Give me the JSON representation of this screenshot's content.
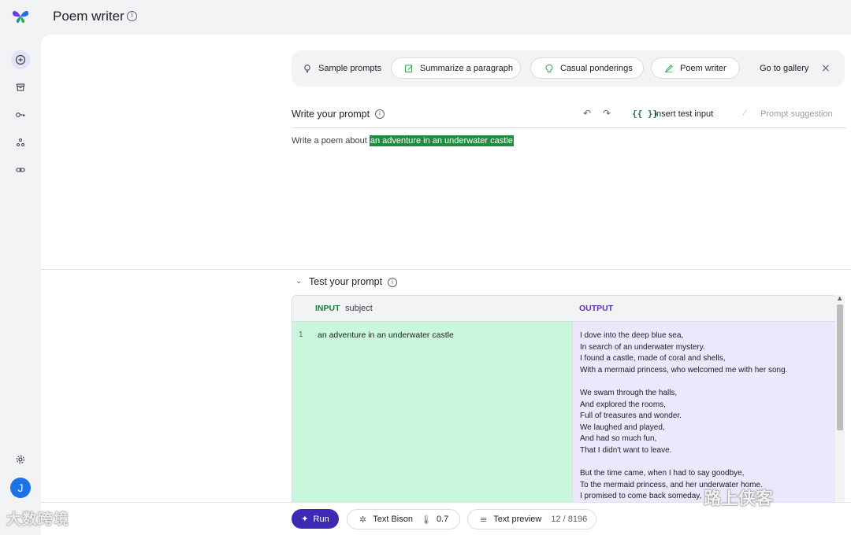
{
  "app": {
    "title": "Poem writer",
    "info_icon": "info-icon",
    "logo_icon": "butterfly-logo",
    "accent": "#3c2ab5"
  },
  "rail": {
    "items": [
      {
        "name": "new-prompt",
        "icon": "plus-circle-icon",
        "active": true
      },
      {
        "name": "library",
        "icon": "archive-icon"
      },
      {
        "name": "api-keys",
        "icon": "key-icon"
      },
      {
        "name": "tuned-models",
        "icon": "nodes-icon"
      },
      {
        "name": "links",
        "icon": "link-icon"
      }
    ],
    "settings_icon": "gear-icon",
    "avatar_initial": "J"
  },
  "chips": {
    "sample_prompts": "Sample prompts",
    "summarize": "Summarize a paragraph",
    "casual": "Casual ponderings",
    "poem_writer": "Poem writer",
    "gallery": "Go to gallery",
    "close": "×"
  },
  "prompt_panel": {
    "title": "Write your prompt",
    "undo": "↶",
    "redo": "↷",
    "insert_icon": "{{ }}",
    "insert_label": "Insert test input",
    "suggestion_label": "Prompt suggestion",
    "text_prefix": "Write a poem about ",
    "text_variable": "an adventure in an underwater castle",
    "variable_color": "#1e8e3e"
  },
  "test_panel": {
    "title": "Test your prompt",
    "input_label": "INPUT",
    "input_name": "subject",
    "output_label": "OUTPUT",
    "input_color": "#188038",
    "output_color": "#5e35b1",
    "rows": [
      {
        "num": "1",
        "input": "an adventure in an underwater castle",
        "output_lines": [
          "I dove into the deep blue sea,",
          "In search of an underwater mystery.",
          "I found a castle, made of coral and shells,",
          "With a mermaid princess, who welcomed me with her song.",
          "",
          "We swam through the halls,",
          "And explored the rooms,",
          "Full of treasures and wonder.",
          "We laughed and played,",
          "And had so much fun,",
          "That I didn't want to leave.",
          "",
          "But the time came, when I had to say goodbye,",
          "To the mermaid princess, and her underwater home.",
          "I promised to come back someday,"
        ]
      }
    ]
  },
  "bottom": {
    "run_label": "Run",
    "model": "Text Bison",
    "temperature": "0.7",
    "preview_label": "Text preview",
    "token_count": "12 / 8196"
  },
  "watermarks": {
    "left": "大数跨境",
    "right": "路上侠客"
  }
}
